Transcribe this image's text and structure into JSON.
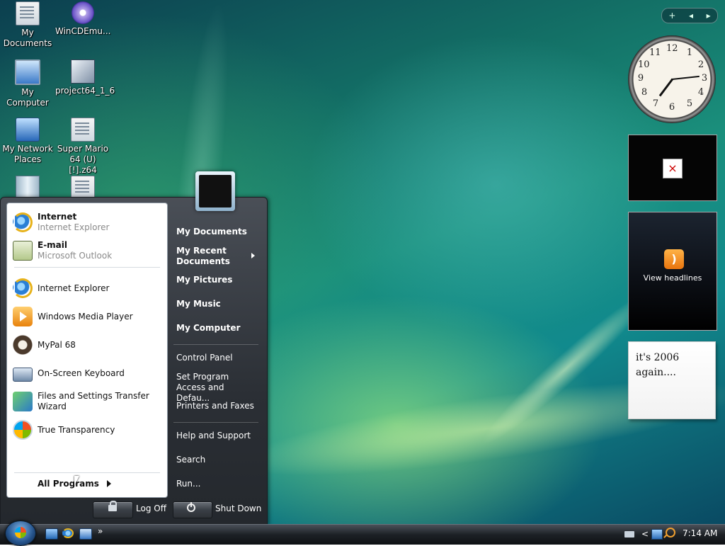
{
  "desktop": {
    "icons": [
      {
        "label": "My\nDocuments",
        "icon": "my-documents-icon"
      },
      {
        "label": "WinCDEmu...",
        "icon": "disc-icon"
      },
      {
        "label": "My Computer",
        "icon": "computer-icon"
      },
      {
        "label": "project64_1_6",
        "icon": "project64-icon"
      },
      {
        "label": "My Network Places",
        "icon": "network-icon"
      },
      {
        "label": "Super Mario 64 (U) [!].z64",
        "icon": "rom-file-icon"
      },
      {
        "label": "",
        "icon": "recycle-bin-icon"
      },
      {
        "label": "",
        "icon": "file-icon"
      }
    ]
  },
  "sidebar": {
    "toolbar": {
      "add": "+",
      "prev": "◂",
      "next": "▸"
    },
    "clock_numbers": [
      "12",
      "1",
      "2",
      "3",
      "4",
      "5",
      "6",
      "7",
      "8",
      "9",
      "10",
      "11"
    ],
    "clock_time": {
      "hour": 7,
      "minute": 14
    },
    "slideshow_broken_icon": "×",
    "feeds_label": "View headlines",
    "note_text": "it's 2006 again...."
  },
  "start_menu": {
    "pinned": [
      {
        "title": "Internet",
        "subtitle": "Internet Explorer",
        "icon": "ie-icon"
      },
      {
        "title": "E-mail",
        "subtitle": "Microsoft Outlook",
        "icon": "outlook-icon"
      }
    ],
    "recent": [
      {
        "label": "Internet Explorer",
        "icon": "ie-icon"
      },
      {
        "label": "Windows Media Player",
        "icon": "media-player-icon"
      },
      {
        "label": "MyPal 68",
        "icon": "mypal-icon"
      },
      {
        "label": "On-Screen Keyboard",
        "icon": "keyboard-icon"
      },
      {
        "label": "Files and Settings Transfer Wizard",
        "icon": "transfer-wizard-icon"
      },
      {
        "label": "True Transparency",
        "icon": "windows-logo-icon"
      }
    ],
    "all_programs": "All Programs",
    "right": {
      "my_documents": "My Documents",
      "my_recent_documents": "My Recent Documents",
      "my_pictures": "My Pictures",
      "my_music": "My Music",
      "my_computer": "My Computer",
      "control_panel": "Control Panel",
      "set_program_access": "Set Program Access and Defau...",
      "printers_and_faxes": "Printers and Faxes",
      "help_and_support": "Help and Support",
      "search": "Search",
      "run": "Run..."
    },
    "log_off": "Log Off",
    "shut_down": "Shut Down"
  },
  "taskbar": {
    "quick_launch_more": "»",
    "tray_chevron": "<",
    "time": "7:14 AM"
  },
  "colors": {
    "desktop_base": "#137066",
    "start_menu_dark": "#2b2f35",
    "taskbar": "#1d2126"
  }
}
